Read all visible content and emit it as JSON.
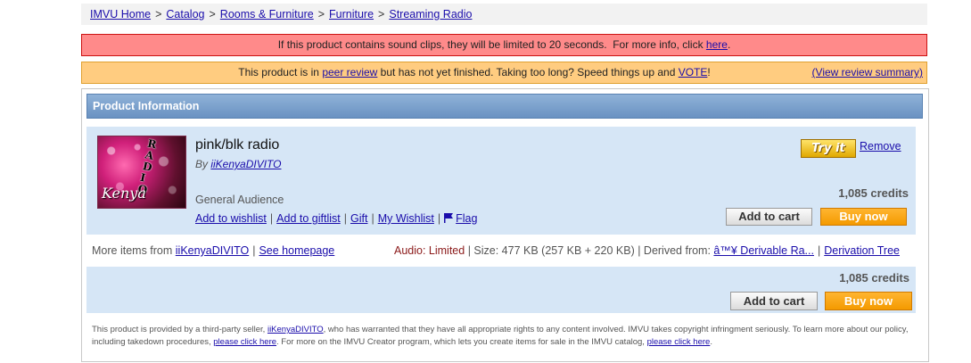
{
  "breadcrumb": {
    "items": [
      "IMVU Home",
      "Catalog",
      "Rooms & Furniture",
      "Furniture",
      "Streaming Radio"
    ],
    "separator": ">"
  },
  "alert_sound": {
    "text": "If this product contains sound clips, they will be limited to 20 seconds.  For more info, click ",
    "link": "here",
    "end": "."
  },
  "alert_review": {
    "pre": "This product is in ",
    "peer_review_link": "peer review",
    "mid": " but has not yet finished. Taking too long? Speed things up and ",
    "vote_link": "VOTE",
    "post": "!",
    "summary_link": "(View review summary)"
  },
  "panel": {
    "header": "Product Information"
  },
  "product": {
    "title": "pink/blk radio",
    "by_prefix": "By ",
    "creator": "iiKenyaDIVITO",
    "audience": "General Audience",
    "thumb_letters": "RADIO",
    "thumb_signature": "Kenya",
    "credits": "1,085 credits",
    "try_it": "Try it",
    "remove": "Remove",
    "add_to_cart": "Add to cart",
    "buy_now": "Buy now",
    "links": {
      "wishlist": "Add to wishlist",
      "giftlist": "Add to giftlist",
      "gift": "Gift",
      "my_wishlist": "My Wishlist",
      "flag": "Flag"
    }
  },
  "more_items": {
    "prefix": "More items from ",
    "creator": "iiKenyaDIVITO",
    "homepage": "See homepage",
    "audio_label": "Audio: Limited",
    "size": " | Size: 477 KB (257 KB + 220 KB) | Derived from: ",
    "derived_link": "â™¥ Derivable Ra...",
    "tree_link": "Derivation Tree"
  },
  "bottom": {
    "credits": "1,085 credits",
    "add_to_cart": "Add to cart",
    "buy_now": "Buy now"
  },
  "disclaimer": {
    "p1": "This product is provided by a third-party seller, ",
    "seller": "iiKenyaDIVITO",
    "p2": ", who has warranted that they have all appropriate rights to any content involved. IMVU takes copyright infringment seriously. To learn more about our policy, including takedown procedures, ",
    "link1": "please click here",
    "p3": ". For more on the IMVU Creator program, which lets you create items for sale in the IMVU catalog, ",
    "link2": "please click here",
    "p4": "."
  }
}
